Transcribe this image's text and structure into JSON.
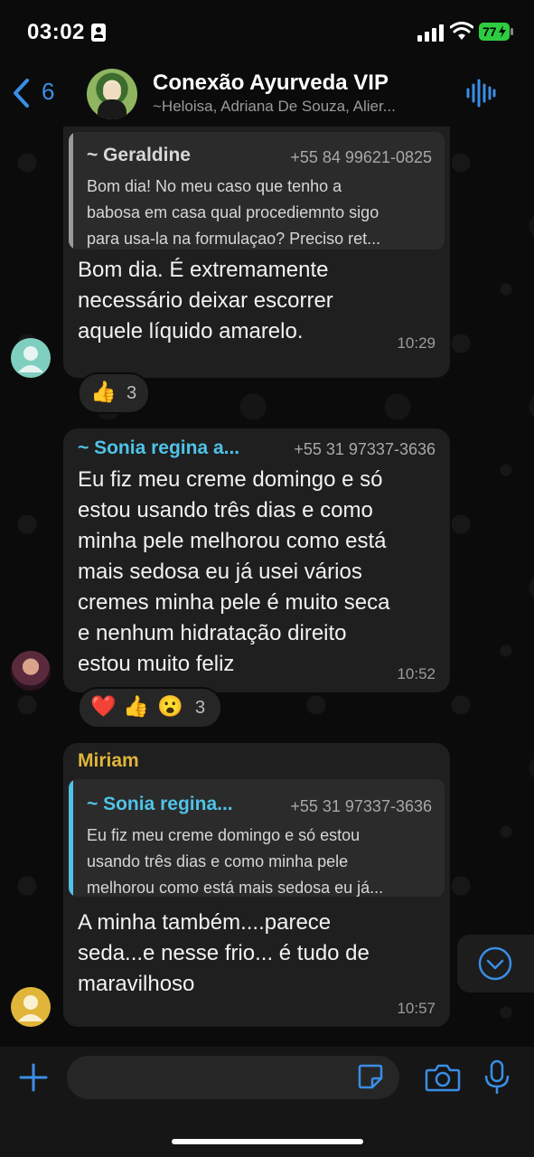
{
  "status_bar": {
    "time": "03:02",
    "battery": "77"
  },
  "header": {
    "back_count": "6",
    "title": "Conexão Ayurveda VIP",
    "members": "~Heloisa, Adriana De Souza, Alier..."
  },
  "messages": [
    {
      "quote": {
        "name": "~ Geraldine",
        "phone": "+55 84 99621-0825",
        "lines": [
          "Bom dia! No meu caso que tenho a",
          "babosa em casa qual procediemnto sigo",
          "para usa-la na formulaçao? Preciso ret..."
        ]
      },
      "lines": [
        "Bom dia. É extremamente",
        "necessário deixar escorrer",
        "aquele líquido amarelo."
      ],
      "time": "10:29",
      "reactions": {
        "emojis": [
          "👍"
        ],
        "count": "3"
      }
    },
    {
      "sender": "~ Sonia regina a...",
      "phone": "+55 31 97337-3636",
      "lines": [
        "Eu fiz meu creme domingo e só",
        "estou usando três dias e como",
        "minha pele melhorou como está",
        "mais sedosa eu já usei vários",
        "cremes minha pele é muito seca",
        "e nenhum hidratação direito",
        "estou muito feliz"
      ],
      "time": "10:52",
      "reactions": {
        "emojis": [
          "❤️",
          "👍",
          "😮"
        ],
        "count": "3"
      }
    },
    {
      "sender": "Miriam",
      "quote": {
        "name": "~ Sonia regina...",
        "phone": "+55 31 97337-3636",
        "lines": [
          "Eu fiz meu creme domingo e só estou",
          "usando três dias e como minha pele",
          "melhorou como está mais sedosa eu já..."
        ]
      },
      "lines": [
        "A minha também....parece",
        "seda...e nesse frio... é tudo de",
        "maravilhoso"
      ],
      "time": "10:57"
    }
  ],
  "input": {
    "value": ""
  },
  "colors": {
    "accent": "#3a8ee6",
    "sonia": "#4fc3e8",
    "miriam": "#e0b53a",
    "quote_bar_1": "#9a9a9a"
  }
}
